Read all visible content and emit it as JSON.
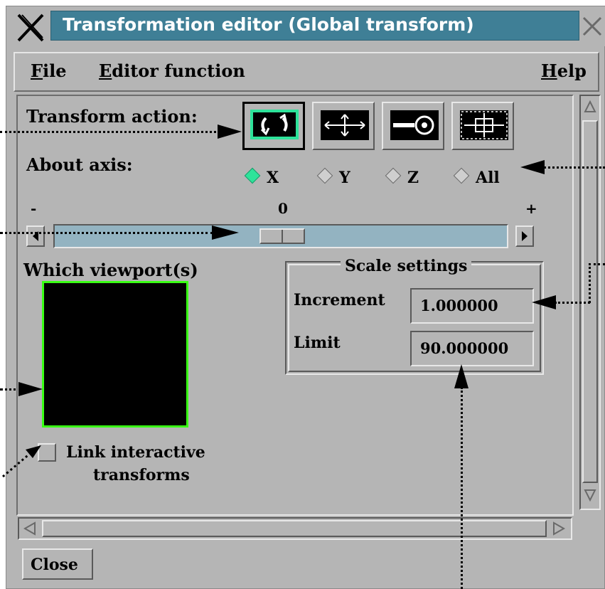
{
  "window": {
    "title": "Transformation editor (Global transform)"
  },
  "menu": {
    "file": "File",
    "editor_function": "Editor function",
    "help": "Help"
  },
  "transform": {
    "label": "Transform action:",
    "buttons": [
      "rotate",
      "translate",
      "scale",
      "flip"
    ],
    "selected": "rotate"
  },
  "axis": {
    "label": "About axis:",
    "options": [
      "X",
      "Y",
      "Z",
      "All"
    ],
    "selected": "X"
  },
  "slider": {
    "min_label": "-",
    "value_label": "0",
    "max_label": "+",
    "position": 0.5
  },
  "viewport": {
    "label": "Which viewport(s)"
  },
  "scale": {
    "title": "Scale settings",
    "increment_label": "Increment",
    "increment_value": "1.000000",
    "limit_label": "Limit",
    "limit_value": "90.000000"
  },
  "link": {
    "label_line1": "Link interactive",
    "label_line2": "transforms"
  },
  "close_label": "Close",
  "colors": {
    "title_bg": "#3f7f96",
    "accent_green": "#2ee39a",
    "viewport_border": "#39ff14",
    "slider_trough": "#93b3c1"
  }
}
